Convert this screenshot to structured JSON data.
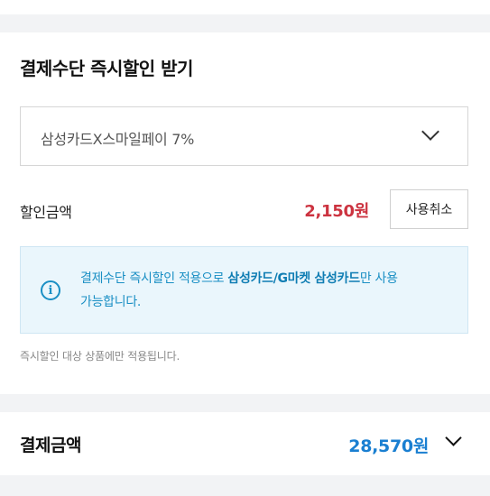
{
  "payment_method": {
    "title": "결제수단 즉시할인 받기",
    "selected_option": "삼성카드X스마일페이 7%",
    "discount_label": "할인금액",
    "discount_amount": "2,150원",
    "cancel_button": "사용취소",
    "info": {
      "text_prefix": "결제수단 즉시할인 적용으로 ",
      "text_bold": "삼성카드/G마켓 삼성카드",
      "text_suffix": "만 사용 가능합니다."
    },
    "note": "즉시할인 대상 상품에만 적용됩니다."
  },
  "total": {
    "label": "결제금액",
    "amount": "28,570원"
  },
  "colors": {
    "discount": "#cc3340",
    "info_text": "#1a8fc4",
    "info_bg": "#eaf6fc",
    "total_amount": "#1a7fd1"
  },
  "icons": [
    "chevron-down-icon",
    "info-icon"
  ]
}
